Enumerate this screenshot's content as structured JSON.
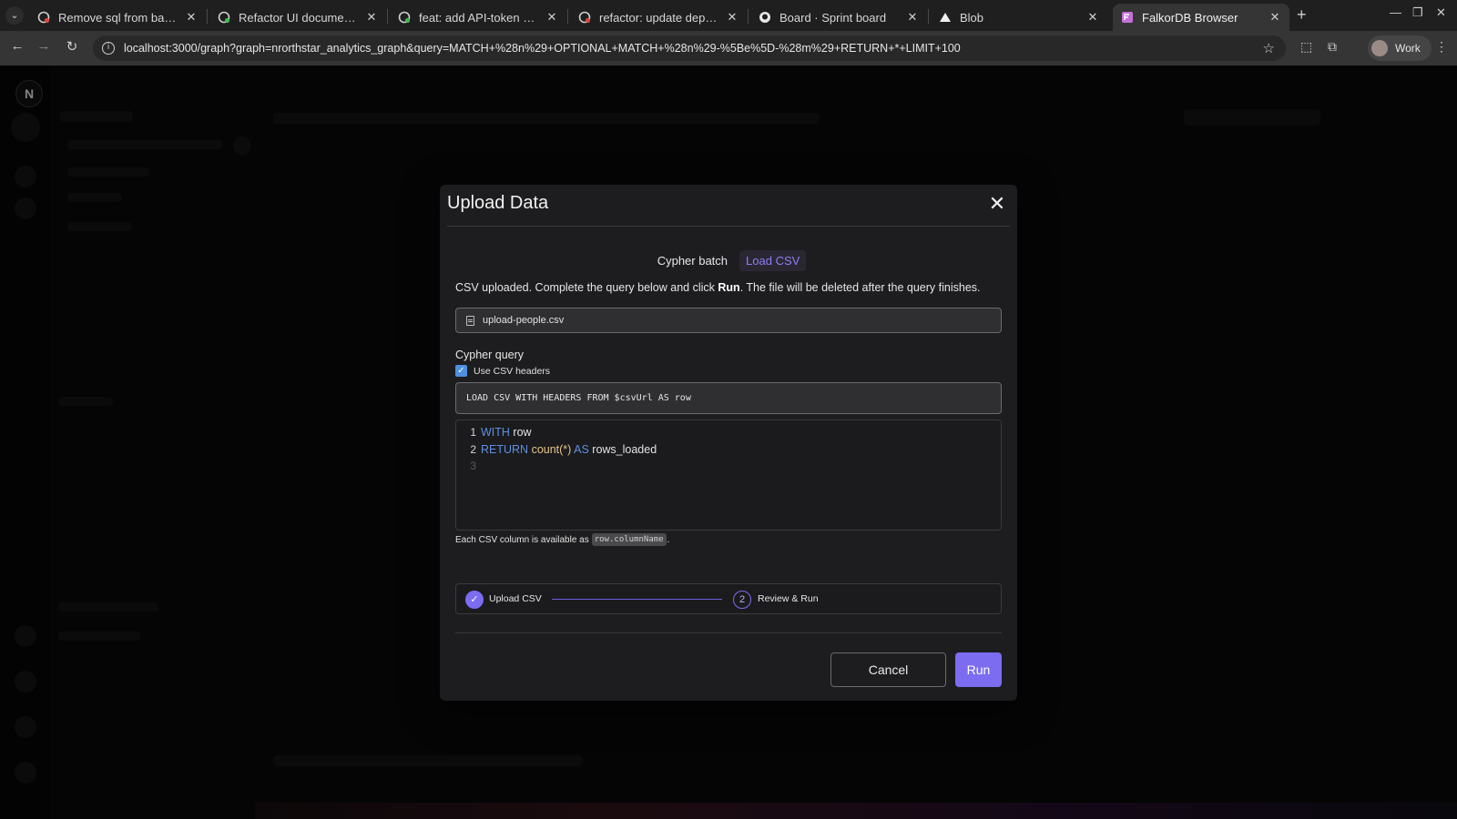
{
  "browser": {
    "tabs": [
      {
        "title": "Remove sql from batch c",
        "favicon": "github-pr-icon",
        "active": false
      },
      {
        "title": "Refactor UI documentati",
        "favicon": "github-pr-icon",
        "active": false
      },
      {
        "title": "feat: add API-token auth",
        "favicon": "github-pr-icon",
        "active": false
      },
      {
        "title": "refactor: update depend",
        "favicon": "github-pr-icon",
        "active": false
      },
      {
        "title": "Board · Sprint board",
        "favicon": "github-icon",
        "active": false
      },
      {
        "title": "Blob",
        "favicon": "vercel-icon",
        "active": false
      },
      {
        "title": "FalkorDB Browser",
        "favicon": "falkordb-icon",
        "active": true
      }
    ],
    "url": "localhost:3000/graph?graph=nrorthstar_analytics_graph&query=MATCH+%28n%29+OPTIONAL+MATCH+%28n%29-%5Be%5D-%28m%29+RETURN+*+LIMIT+100",
    "profile_label": "Work",
    "accent_color": "#7b6cf0"
  },
  "app": {
    "logo_letter": "N"
  },
  "modal": {
    "title": "Upload Data",
    "mode_tabs": [
      {
        "label": "Cypher batch",
        "active": false
      },
      {
        "label": "Load CSV",
        "active": true
      }
    ],
    "info_before": "CSV uploaded. Complete the query below and click ",
    "info_bold": "Run",
    "info_after": ". The file will be deleted after the query finishes.",
    "file_name": "upload-people.csv",
    "query_label": "Cypher query",
    "use_headers_label": "Use CSV headers",
    "use_headers_checked": true,
    "query_prefix": "LOAD CSV WITH HEADERS FROM $csvUrl AS row",
    "editor_lines": [
      {
        "num": "1",
        "tokens": [
          {
            "t": "WITH",
            "c": "kw"
          },
          {
            "t": " row",
            "c": "id"
          }
        ]
      },
      {
        "num": "2",
        "tokens": [
          {
            "t": "RETURN",
            "c": "kw"
          },
          {
            "t": " count(*)",
            "c": "fn"
          },
          {
            "t": " AS",
            "c": "kw"
          },
          {
            "t": " rows_loaded",
            "c": "id"
          }
        ]
      },
      {
        "num": "3",
        "tokens": []
      }
    ],
    "hint_text": "Each CSV column is available as",
    "hint_code": "row.columnName",
    "hint_suffix": ".",
    "steps": [
      {
        "label": "Upload CSV",
        "state": "done",
        "marker": "✓"
      },
      {
        "label": "Review & Run",
        "state": "pending",
        "marker": "2"
      }
    ],
    "cancel_label": "Cancel",
    "run_label": "Run"
  }
}
